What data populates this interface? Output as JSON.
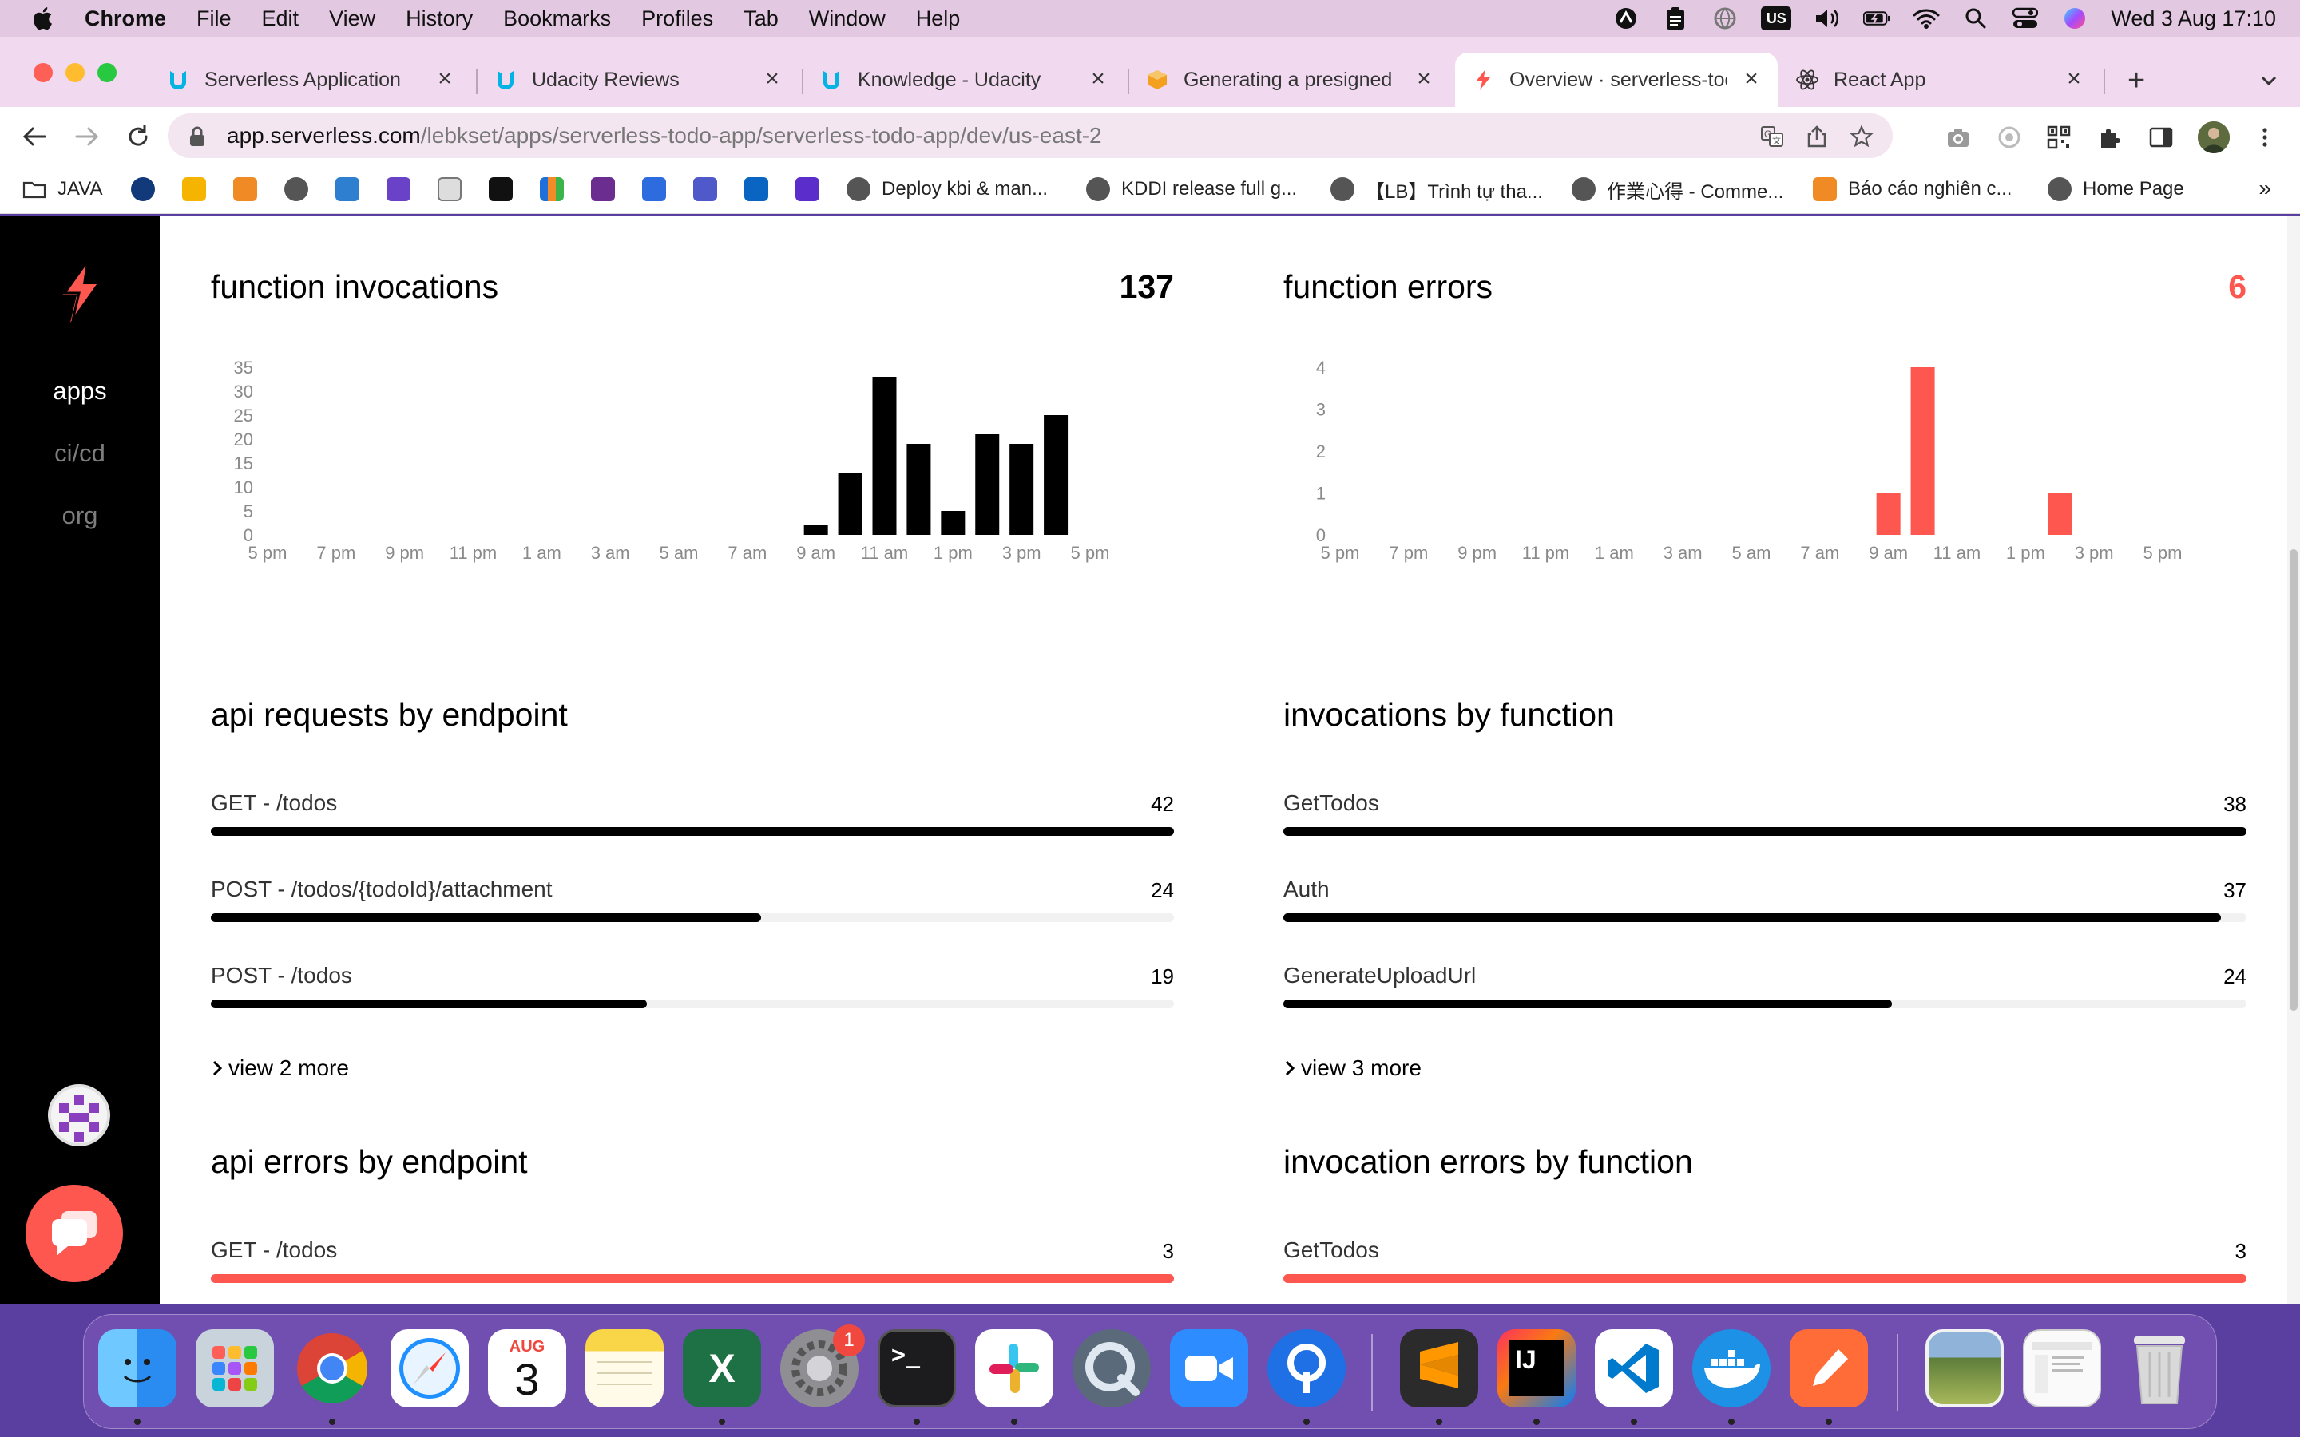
{
  "menubar": {
    "app": "Chrome",
    "items": [
      "File",
      "Edit",
      "View",
      "History",
      "Bookmarks",
      "Profiles",
      "Tab",
      "Window",
      "Help"
    ],
    "input_source": "US",
    "clock": "Wed 3 Aug  17:10"
  },
  "tabs": [
    {
      "title": "Serverless Application",
      "active": false
    },
    {
      "title": "Udacity Reviews",
      "active": false
    },
    {
      "title": "Knowledge - Udacity",
      "active": false
    },
    {
      "title": "Generating a presigned URL",
      "active": false
    },
    {
      "title": "Overview · serverless-todo",
      "active": true
    },
    {
      "title": "React App",
      "active": false
    }
  ],
  "address_bar": {
    "host": "app.serverless.com",
    "path": "/lebkset/apps/serverless-todo-app/serverless-todo-app/dev/us-east-2"
  },
  "bookmarks": {
    "first_folder": "JAVA",
    "items": [
      "Deploy kbi & man...",
      "KDDI release full g...",
      "【LB】Trình tự tha...",
      "作業心得 - Comme...",
      "Báo cáo nghiên c...",
      "Home Page"
    ],
    "overflow": "»"
  },
  "sidebar": {
    "nav": [
      {
        "label": "apps",
        "active": true
      },
      {
        "label": "ci/cd",
        "active": false
      },
      {
        "label": "org",
        "active": false
      }
    ]
  },
  "colors": {
    "accent": "#fd5750",
    "bar": "#000000",
    "sidebar": "#000000",
    "track": "#f1f1f1"
  },
  "panels": {
    "invocations": {
      "title": "function invocations",
      "total": "137"
    },
    "errors": {
      "title": "function errors",
      "total": "6"
    },
    "api_requests": {
      "title": "api requests by endpoint",
      "max": 42,
      "rows": [
        {
          "label": "GET - /todos",
          "value": 42
        },
        {
          "label": "POST - /todos/{todoId}/attachment",
          "value": 24
        },
        {
          "label": "POST - /todos",
          "value": 19
        }
      ],
      "more": "view 2 more"
    },
    "invocations_by_function": {
      "title": "invocations by function",
      "max": 38,
      "rows": [
        {
          "label": "GetTodos",
          "value": 38
        },
        {
          "label": "Auth",
          "value": 37
        },
        {
          "label": "GenerateUploadUrl",
          "value": 24
        }
      ],
      "more": "view 3 more"
    },
    "api_errors": {
      "title": "api errors by endpoint",
      "max": 3,
      "rows": [
        {
          "label": "GET - /todos",
          "value": 3
        }
      ]
    },
    "invocation_errors": {
      "title": "invocation errors by function",
      "max": 3,
      "rows": [
        {
          "label": "GetTodos",
          "value": 3
        }
      ]
    }
  },
  "chart_data": [
    {
      "type": "bar",
      "title": "function invocations",
      "x_ticks": [
        "5 pm",
        "7 pm",
        "9 pm",
        "11 pm",
        "1 am",
        "3 am",
        "5 am",
        "7 am",
        "9 am",
        "11 am",
        "1 pm",
        "3 pm",
        "5 pm"
      ],
      "y_ticks": [
        0,
        5,
        10,
        15,
        20,
        25,
        30,
        35
      ],
      "ylim": [
        0,
        35
      ],
      "x": [
        "9 am",
        "10 am",
        "11 am",
        "12 pm",
        "1 pm",
        "2 pm",
        "3 pm",
        "4 pm"
      ],
      "values": [
        2,
        13,
        33,
        19,
        5,
        21,
        19,
        25
      ],
      "color": "#000000",
      "grid": false
    },
    {
      "type": "bar",
      "title": "function errors",
      "x_ticks": [
        "5 pm",
        "7 pm",
        "9 pm",
        "11 pm",
        "1 am",
        "3 am",
        "5 am",
        "7 am",
        "9 am",
        "11 am",
        "1 pm",
        "3 pm",
        "5 pm"
      ],
      "y_ticks": [
        0,
        1,
        2,
        3,
        4
      ],
      "ylim": [
        0,
        4
      ],
      "x": [
        "9 am",
        "10 am",
        "2 pm"
      ],
      "values": [
        1,
        4,
        1
      ],
      "color": "#fd5750",
      "grid": false
    }
  ],
  "dock": {
    "calendar_month": "AUG",
    "calendar_day": "3",
    "settings_badge": "1",
    "apps": [
      "finder-icon",
      "launchpad-icon",
      "chrome-icon",
      "safari-icon",
      "calendar-icon",
      "notes-icon",
      "excel-icon",
      "system-preferences-icon",
      "terminal-icon",
      "slack-icon",
      "quicktime-icon",
      "zoom-icon",
      "proxyman-icon",
      "sublime-text-icon",
      "intellij-icon",
      "vscode-icon",
      "docker-icon",
      "postman-icon",
      "photos-preview-icon",
      "finder-window-icon",
      "trash-icon"
    ]
  }
}
